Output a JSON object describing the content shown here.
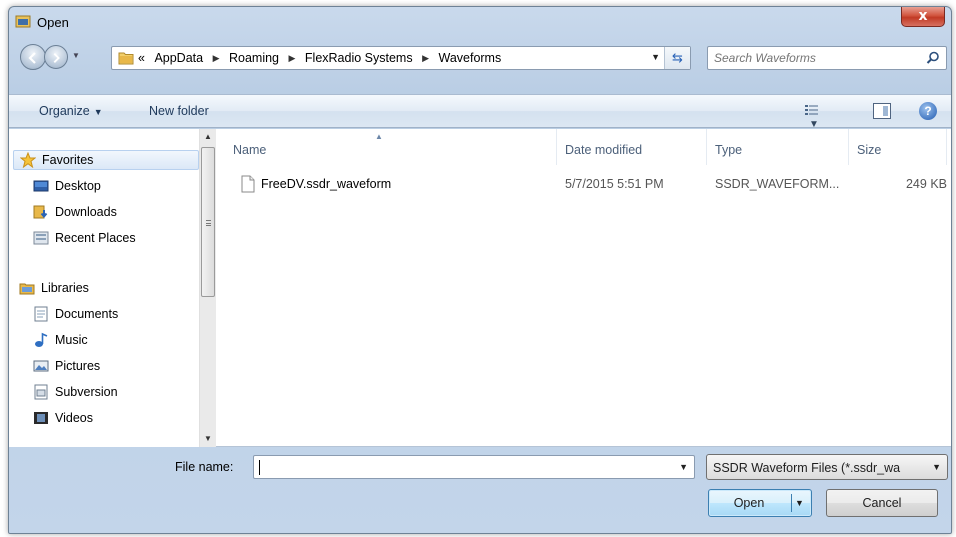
{
  "window": {
    "title": "Open",
    "close_glyph": "x"
  },
  "address": {
    "overflow_glyph": "«",
    "breadcrumbs": [
      "AppData",
      "Roaming",
      "FlexRadio Systems",
      "Waveforms"
    ],
    "separator_glyph": "▶"
  },
  "search": {
    "placeholder": "Search Waveforms"
  },
  "toolbar": {
    "organize_label": "Organize",
    "new_folder_label": "New folder",
    "help_glyph": "?"
  },
  "navigation": {
    "favorites_label": "Favorites",
    "favorites": [
      {
        "label": "Desktop",
        "icon": "desktop-icon"
      },
      {
        "label": "Downloads",
        "icon": "downloads-icon"
      },
      {
        "label": "Recent Places",
        "icon": "recent-places-icon"
      }
    ],
    "libraries_label": "Libraries",
    "libraries": [
      {
        "label": "Documents",
        "icon": "documents-icon"
      },
      {
        "label": "Music",
        "icon": "music-icon"
      },
      {
        "label": "Pictures",
        "icon": "pictures-icon"
      },
      {
        "label": "Subversion",
        "icon": "subversion-icon"
      },
      {
        "label": "Videos",
        "icon": "videos-icon"
      }
    ]
  },
  "columns": {
    "name": "Name",
    "date": "Date modified",
    "type": "Type",
    "size": "Size"
  },
  "files": [
    {
      "name": "FreeDV.ssdr_waveform",
      "date": "5/7/2015 5:51 PM",
      "type": "SSDR_WAVEFORM...",
      "size": "249 KB"
    }
  ],
  "bottom": {
    "file_name_label": "File name:",
    "file_name_value": "",
    "filter_label": "SSDR Waveform Files (*.ssdr_wa",
    "open_label": "Open",
    "cancel_label": "Cancel"
  },
  "colors": {
    "accent": "#3c7fb1",
    "close": "#c13a25",
    "folder": "#e8b84a"
  }
}
